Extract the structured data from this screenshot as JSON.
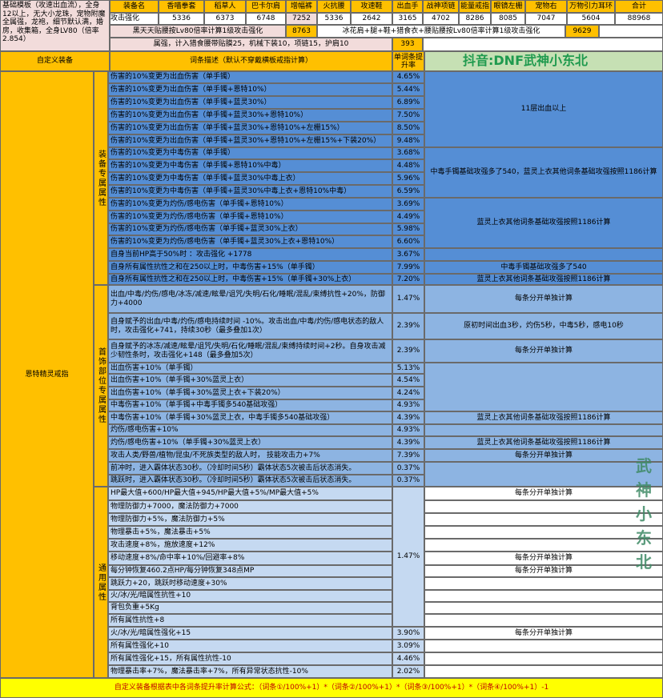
{
  "top_note": "基础模板（攻速出血流），全身12以上，无大小龙珠，宠物附魔全属强，龙袍，细节默认满，婚房，收集箱，全身LV80（倍率2.854）",
  "header_row": [
    "装备名",
    "香喵拳套",
    "稻草人",
    "巴卡尔肩",
    "增幅裤",
    "火抗腰",
    "攻速鞋",
    "出血手",
    "战神项链",
    "能量戒指",
    "眼镜左栅",
    "宠物右",
    "万物引力耳环",
    "合计"
  ],
  "attack_row": {
    "label": "攻击强化",
    "values": [
      "5336",
      "6373",
      "6748",
      "7252",
      "5336",
      "2642",
      "3165",
      "4702",
      "8286",
      "8085",
      "7047",
      "5604",
      "88968"
    ]
  },
  "row3": {
    "text_a": "黑天天贴腰按Lv80倍率计算1级攻击强化",
    "value_a": "8763",
    "text_b": "冰花肩+腿+鞋+猎食衣+腰贴腰按Lv80倍率计算1级攻击强化",
    "value_b": "9629"
  },
  "row4": {
    "text": "属强，计入猎食腰带贴膜25，机械下装10，项链15，护肩10",
    "value": "393"
  },
  "columns": {
    "equip": "自定义装备",
    "desc": "词条描述（默认不穿戴横板戒指计算）",
    "rate": "单词条提升率"
  },
  "watermark_top": "抖音:DNF武神小东北",
  "watermark_side": [
    "武",
    "神",
    "小",
    "东",
    "北"
  ],
  "equip_name": "恩特精灵戒指",
  "groups": [
    "装备专属属性",
    "首饰部位专属属性",
    "通用属性"
  ],
  "rows": [
    {
      "d": "伤害的10%变更为出血伤害（单手镯）",
      "r": "4.65%"
    },
    {
      "d": "伤害的10%变更为出血伤害（单手镯+恩特10%）",
      "r": "5.44%"
    },
    {
      "d": "伤害的10%变更为出血伤害（单手镯+蓝灵30%）",
      "r": "6.89%"
    },
    {
      "d": "伤害的10%变更为出血伤害（单手镯+蓝灵30%+恩特10%）",
      "r": "7.50%"
    },
    {
      "d": "伤害的10%变更为出血伤害（单手镯+蓝灵30%+恩特10%+左栅15%）",
      "r": "8.50%"
    },
    {
      "d": "伤害的10%变更为出血伤害（单手镯+蓝灵30%+恩特10%+左栅15%+下装20%）",
      "r": "9.48%"
    },
    {
      "d": "伤害的10%变更为中毒伤害（单手镯）",
      "r": "3.68%"
    },
    {
      "d": "伤害的10%变更为中毒伤害（单手镯+恩特10%中毒）",
      "r": "4.48%"
    },
    {
      "d": "伤害的10%变更为中毒伤害（单手镯+蓝灵30%中毒上衣）",
      "r": "5.96%"
    },
    {
      "d": "伤害的10%变更为中毒伤害（单手镯+蓝灵30%中毒上衣+恩特10%中毒）",
      "r": "6.59%"
    },
    {
      "d": "伤害的10%变更为灼伤/感电伤害（单手镯+恩特10%）",
      "r": "3.69%"
    },
    {
      "d": "伤害的10%变更为灼伤/感电伤害（单手镯+恩特10%）",
      "r": "4.49%"
    },
    {
      "d": "伤害的10%变更为灼伤/感电伤害（单手镯+蓝灵30%上衣）",
      "r": "5.98%"
    },
    {
      "d": "伤害的10%变更为灼伤/感电伤害（单手镯+蓝灵30%上衣+恩特10%）",
      "r": "6.60%"
    },
    {
      "d": "自身当前HP高于50%时 ：攻击强化 +1778",
      "r": "3.67%"
    },
    {
      "d": "自身所有属性抗性之和在250以上时，中毒伤害+15%（单手镯）",
      "r": "7.99%"
    },
    {
      "d": "自身所有属性抗性之和在250以上时，中毒伤害+15%（单手镯+30%上衣）",
      "r": "7.20%"
    },
    {
      "d": "出血/中毒/灼伤/感电/冰冻/减速/眩晕/诅咒/失明/石化/睡眠/混乱/束缚抗性+20%，防御力+4000",
      "r": "1.47%"
    },
    {
      "d": "自身赋予的出血/中毒/灼伤/感电持续时间 -10%。攻击出血/中毒/灼伤/感电状态的敌人时，攻击强化+741，持续30秒（最多叠加1次）",
      "r": "2.39%"
    },
    {
      "d": "自身赋予的冰冻/减速/眩晕/诅咒/失明/石化/睡眠/混乱/束缚持续时间+2秒。自身攻击减少韧性条时，攻击强化+148（最多叠加5次）",
      "r": "2.39%"
    },
    {
      "d": "出血伤害+10%（单手镯）",
      "r": "5.13%"
    },
    {
      "d": "出血伤害+10%（单手镯+30%蓝灵上衣）",
      "r": "4.54%"
    },
    {
      "d": "出血伤害+10%（单手镯+30%蓝灵上衣+下装20%）",
      "r": "4.24%"
    },
    {
      "d": "中毒伤害+10%（单手镯+中毒手镯多540基础攻强）",
      "r": "4.93%"
    },
    {
      "d": "中毒伤害+10%（单手镯+30%蓝灵上衣，中毒手镯多540基础攻强）",
      "r": "4.39%"
    },
    {
      "d": "灼伤/感电伤害+10%",
      "r": "4.93%"
    },
    {
      "d": "灼伤/感电伤害+10%（单手镯+30%蓝灵上衣）",
      "r": "4.39%"
    },
    {
      "d": "攻击人类/野兽/植物/昆虫/不死族类型的敌人时， 技能攻击力+7%",
      "r": "7.39%"
    },
    {
      "d": "前冲时，进入霸体状态30秒。（冷却时间5秒）霸体状态5次被击后状态消失。",
      "r": "0.37%"
    },
    {
      "d": "跳跃时，进入霸体状态30秒。（冷却时间5秒）霸体状态5次被击后状态消失。",
      "r": "0.37%"
    },
    {
      "d": "HP最大值+600/HP最大值+945/HP最大值+5%/MP最大值+5%",
      "r": ""
    },
    {
      "d": "物理防御力+7000，魔法防御力+7000",
      "r": ""
    },
    {
      "d": "物理防御力+5%，魔法防御力+5%",
      "r": ""
    },
    {
      "d": "物理暴击+5%，魔法暴击+5%",
      "r": ""
    },
    {
      "d": "攻击速度+8%，施放速度+12%",
      "r": ""
    },
    {
      "d": "移动速度+8%/命中率+10%/回避率+8%",
      "r": "1.47%"
    },
    {
      "d": "每分钟恢复460.2点HP/每分钟恢复348点MP",
      "r": ""
    },
    {
      "d": "跳跃力+20，跳跃时移动速度+30%",
      "r": ""
    },
    {
      "d": "火/冰/光/暗属性抗性+10",
      "r": ""
    },
    {
      "d": "背包负重+5Kg",
      "r": ""
    },
    {
      "d": "所有属性抗性+8",
      "r": ""
    },
    {
      "d": "火/冰/光/暗属性强化+15",
      "r": "3.90%"
    },
    {
      "d": "所有属性强化+10",
      "r": "3.09%"
    },
    {
      "d": "所有属性强化+15，所有属性抗性-10",
      "r": "4.46%"
    },
    {
      "d": "物理暴击率+7%，魔法暴击率+7%，所有异常状态抗性-10%",
      "r": "2.02%"
    }
  ],
  "notes": {
    "n1": "11层出血以上",
    "n2": "中毒手镯基础攻强多了540，蓝灵上衣其他词条基础攻强按照1186计算",
    "n3": "蓝灵上衣其他词条基础攻强按照1186计算",
    "n4": "中毒手镯基础攻强多了540",
    "n5": "蓝灵上衣其他词条基础攻强按照1186计算",
    "n6": "每条分开单独计算",
    "n7": "原初时间出血3秒，灼伤5秒，中毒5秒，感电10秒",
    "n8": "每条分开单独计算",
    "n9": "蓝灵上衣其他词条基础攻强按照1186计算",
    "n10": "蓝灵上衣其他词条基础攻强按照1186计算",
    "n11": "每条分开单独计算",
    "n12": "每条分开单独计算"
  },
  "footer": "自定义装备根据表中各词条提升率计算公式：（词条①/100%+1）*（词条②/100%+1）*（词条③/100%+1）*（词条④/100%+1）-1"
}
